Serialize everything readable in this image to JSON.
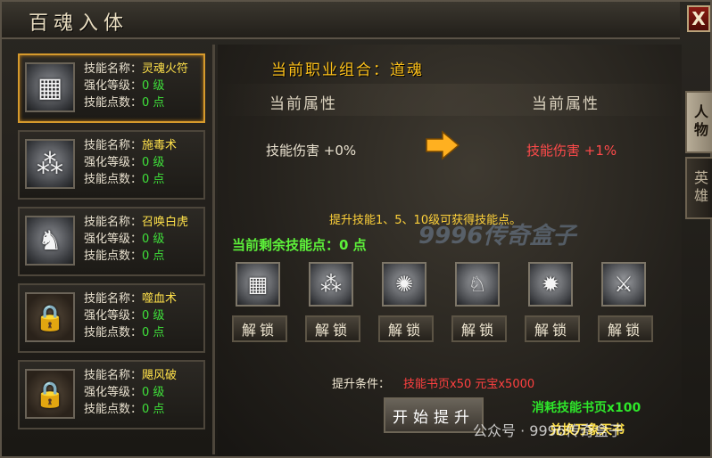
{
  "window": {
    "title": "百魂入体",
    "close_label": "X"
  },
  "side_tabs": [
    {
      "label": "人物"
    },
    {
      "label": "英雄"
    }
  ],
  "skills": [
    {
      "name_label": "技能名称：",
      "name": "灵魂火符",
      "level_label": "强化等级：",
      "level": "0 级",
      "points_label": "技能点数：",
      "points": "0 点",
      "icon": "talisman-icon",
      "selected": true
    },
    {
      "name_label": "技能名称：",
      "name": "施毒术",
      "level_label": "强化等级：",
      "level": "0 级",
      "points_label": "技能点数：",
      "points": "0 点",
      "icon": "poison-icon"
    },
    {
      "name_label": "技能名称：",
      "name": "召唤白虎",
      "level_label": "强化等级：",
      "level": "0 级",
      "points_label": "技能点数：",
      "points": "0 点",
      "icon": "tiger-icon"
    },
    {
      "name_label": "技能名称：",
      "name": "噬血术",
      "level_label": "强化等级：",
      "level": "0 级",
      "points_label": "技能点数：",
      "points": "0 点",
      "icon": "lock-icon"
    },
    {
      "name_label": "技能名称：",
      "name": "飓风破",
      "level_label": "强化等级：",
      "level": "0 级",
      "points_label": "技能点数：",
      "points": "0 点",
      "icon": "lock-icon"
    }
  ],
  "main": {
    "combo": "当前职业组合：道魂",
    "attr_header_left": "当前属性",
    "attr_header_right": "当前属性",
    "attr_left": "技能伤害 +0%",
    "attr_right": "技能伤害 +1%",
    "hint": "提升技能1、5、10级可获得技能点。",
    "remain_label": "当前剩余技能点：",
    "remain_value": "0 点",
    "slots": [
      {
        "icon": "talisman-icon",
        "button": "解锁"
      },
      {
        "icon": "poison-icon",
        "button": "解锁"
      },
      {
        "icon": "ring-icon",
        "button": "解锁"
      },
      {
        "icon": "dragon-icon",
        "button": "解锁"
      },
      {
        "icon": "fire-icon",
        "button": "解锁"
      },
      {
        "icon": "sword-icon",
        "button": "解锁"
      }
    ],
    "condition_label": "提升条件：",
    "condition_value": "技能书页x50 元宝x5000",
    "start_button": "开始提升",
    "consume": "消耗技能书页x100",
    "exchange": "兑换万象天书"
  },
  "watermarks": {
    "center": "9996传奇盒子",
    "corner": "公众号 · 9996传奇盒子"
  },
  "colors": {
    "gold": "#ffc21a",
    "green": "#3fe03a",
    "red": "#ff4040",
    "yellow": "#ffe14a"
  }
}
